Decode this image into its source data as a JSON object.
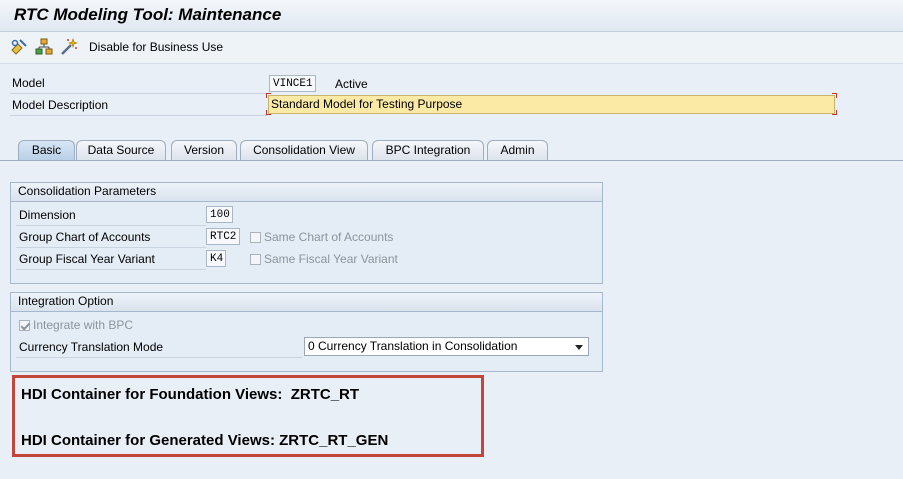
{
  "window": {
    "title": "RTC Modeling Tool: Maintenance"
  },
  "toolbar": {
    "icons": [
      "display-change-icon",
      "hierarchy-icon",
      "magic-wand-icon"
    ],
    "disable_label": "Disable for Business Use"
  },
  "header": {
    "model_label": "Model",
    "model_value": "VINCE1",
    "model_status": "Active",
    "description_label": "Model Description",
    "description_value": "Standard Model for Testing Purpose"
  },
  "tabs": [
    {
      "label": "Basic",
      "active": true
    },
    {
      "label": "Data Source",
      "active": false
    },
    {
      "label": "Version",
      "active": false
    },
    {
      "label": "Consolidation View",
      "active": false
    },
    {
      "label": "BPC Integration",
      "active": false
    },
    {
      "label": "Admin",
      "active": false
    }
  ],
  "consolidation": {
    "title": "Consolidation Parameters",
    "dimension_label": "Dimension",
    "dimension_value": "100",
    "coa_label": "Group Chart of Accounts",
    "coa_value": "RTC2",
    "same_coa_label": "Same Chart of Accounts",
    "same_coa_checked": false,
    "fyv_label": "Group Fiscal Year Variant",
    "fyv_value": "K4",
    "same_fyv_label": "Same Fiscal Year Variant",
    "same_fyv_checked": false
  },
  "integration": {
    "title": "Integration Option",
    "integrate_label": "Integrate with BPC",
    "integrate_checked": true,
    "ctm_label": "Currency Translation Mode",
    "ctm_value": "0 Currency Translation in Consolidation"
  },
  "hdi": {
    "foundation_line": "HDI Container for Foundation Views:  ZRTC_RT",
    "generated_line": "HDI Container for Generated Views: ZRTC_RT_GEN"
  },
  "colors": {
    "highlight_border": "#c0473a",
    "required_field_bg": "#fbeaa6",
    "background": "#e9eff6"
  }
}
